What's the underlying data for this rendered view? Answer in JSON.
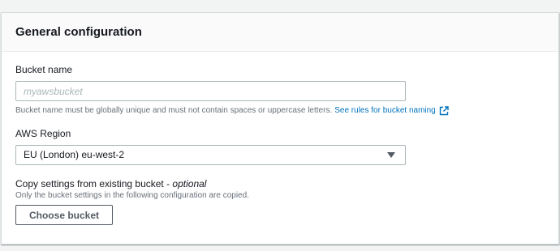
{
  "panel": {
    "title": "General configuration"
  },
  "bucket_name": {
    "label": "Bucket name",
    "placeholder": "myawsbucket",
    "value": "",
    "hint": "Bucket name must be globally unique and must not contain spaces or uppercase letters.",
    "rules_link": "See rules for bucket naming",
    "link_icon": "external-link-icon"
  },
  "region": {
    "label": "AWS Region",
    "selected": "EU (London) eu-west-2",
    "caret_icon": "caret-down-icon"
  },
  "copy_settings": {
    "label": "Copy settings from existing bucket - ",
    "optional": "optional",
    "hint": "Only the bucket settings in the following configuration are copied.",
    "button_label": "Choose bucket"
  },
  "colors": {
    "link": "#0073bb",
    "text": "#16191f",
    "hint": "#687078",
    "border": "#aab7b8"
  }
}
